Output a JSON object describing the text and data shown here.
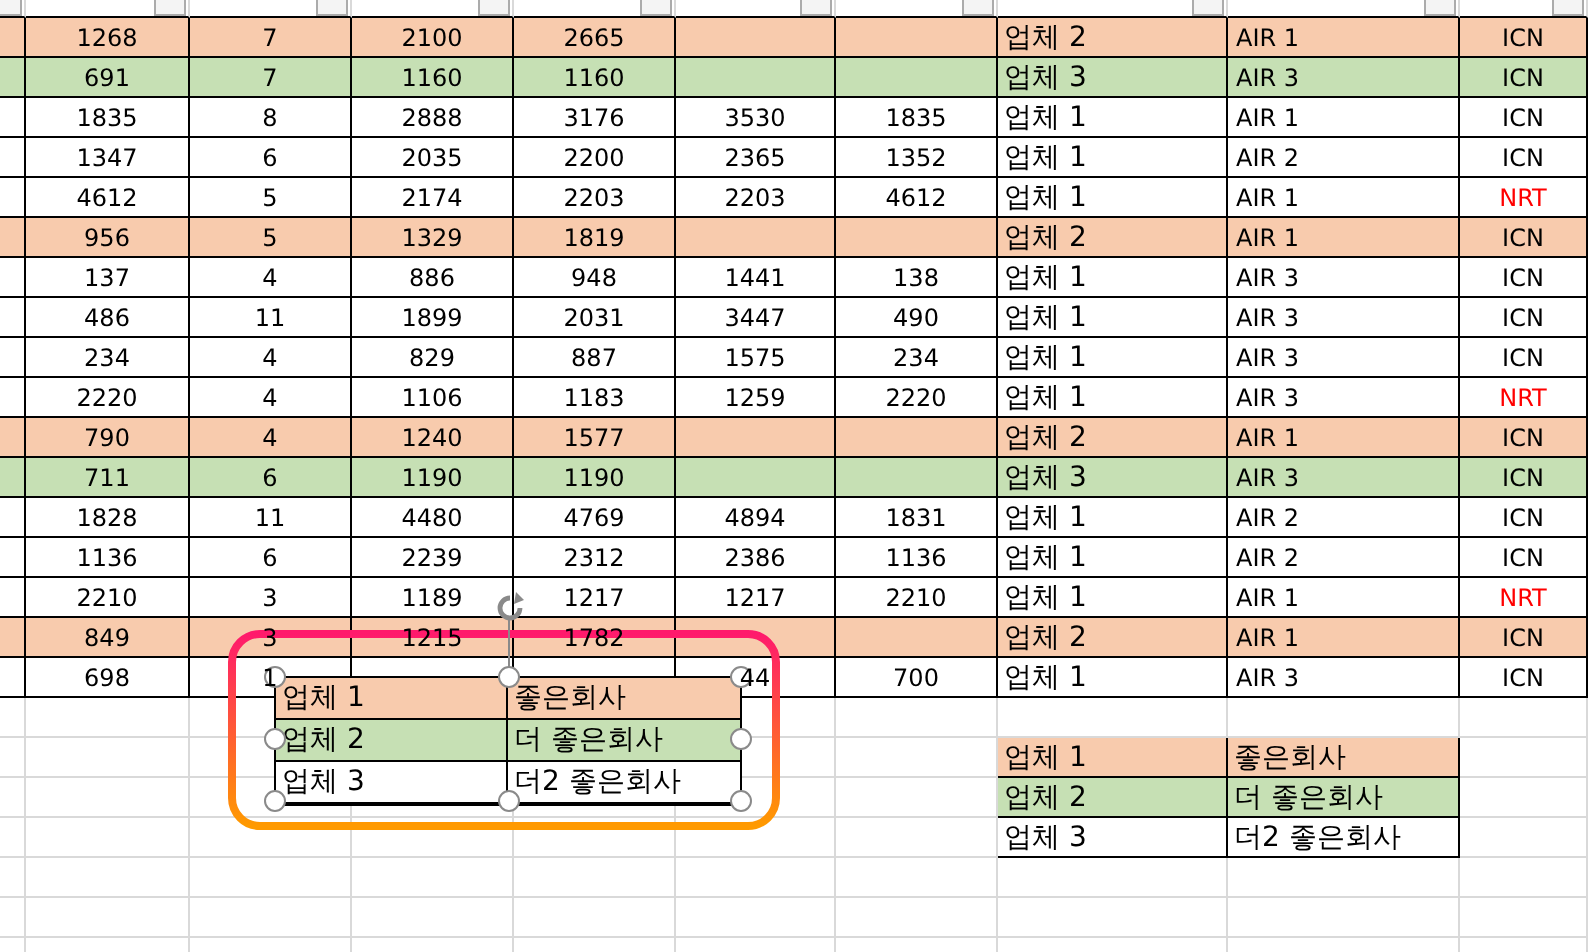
{
  "rows": [
    {
      "color": "#f8cbad",
      "values": {
        "column_2": "1268",
        "column_3": "7",
        "column_4": "2100",
        "column_5": "2665"
      },
      "company": "업체 2",
      "air": "AIR 1",
      "airport": "ICN",
      "flagged": false
    },
    {
      "color": "#c6e0b4",
      "values": {
        "column_2": "691",
        "column_3": "7",
        "column_4": "1160",
        "column_5": "1160"
      },
      "company": "업체 3",
      "air": "AIR 3",
      "airport": "ICN",
      "flagged": false
    },
    {
      "color": "#ffffff",
      "values": {
        "column_2": "1835",
        "column_3": "8",
        "column_4": "2888",
        "column_5": "3176",
        "column_6": "3530",
        "column_7": "1835"
      },
      "company": "업체 1",
      "air": "AIR 1",
      "airport": "ICN",
      "flagged": false
    },
    {
      "color": "#ffffff",
      "values": {
        "column_2": "1347",
        "column_3": "6",
        "column_4": "2035",
        "column_5": "2200",
        "column_6": "2365",
        "column_7": "1352"
      },
      "company": "업체 1",
      "air": "AIR 2",
      "airport": "ICN",
      "flagged": false
    },
    {
      "color": "#ffffff",
      "values": {
        "column_2": "4612",
        "column_3": "5",
        "column_4": "2174",
        "column_5": "2203",
        "column_6": "2203",
        "column_7": "4612"
      },
      "company": "업체 1",
      "air": "AIR 1",
      "airport": "NRT",
      "flagged": true
    },
    {
      "color": "#f8cbad",
      "values": {
        "column_2": "956",
        "column_3": "5",
        "column_4": "1329",
        "column_5": "1819"
      },
      "company": "업체 2",
      "air": "AIR 1",
      "airport": "ICN",
      "flagged": false
    },
    {
      "color": "#ffffff",
      "values": {
        "column_2": "137",
        "column_3": "4",
        "column_4": "886",
        "column_5": "948",
        "column_6": "1441",
        "column_7": "138"
      },
      "company": "업체 1",
      "air": "AIR 3",
      "airport": "ICN",
      "flagged": false
    },
    {
      "color": "#ffffff",
      "values": {
        "column_2": "486",
        "column_3": "11",
        "column_4": "1899",
        "column_5": "2031",
        "column_6": "3447",
        "column_7": "490"
      },
      "company": "업체 1",
      "air": "AIR 3",
      "airport": "ICN",
      "flagged": false
    },
    {
      "color": "#ffffff",
      "values": {
        "column_2": "234",
        "column_3": "4",
        "column_4": "829",
        "column_5": "887",
        "column_6": "1575",
        "column_7": "234"
      },
      "company": "업체 1",
      "air": "AIR 3",
      "airport": "ICN",
      "flagged": false
    },
    {
      "color": "#ffffff",
      "values": {
        "column_2": "2220",
        "column_3": "4",
        "column_4": "1106",
        "column_5": "1183",
        "column_6": "1259",
        "column_7": "2220"
      },
      "company": "업체 1",
      "air": "AIR 3",
      "airport": "NRT",
      "flagged": true
    },
    {
      "color": "#f8cbad",
      "values": {
        "column_2": "790",
        "column_3": "4",
        "column_4": "1240",
        "column_5": "1577"
      },
      "company": "업체 2",
      "air": "AIR 1",
      "airport": "ICN",
      "flagged": false
    },
    {
      "color": "#c6e0b4",
      "values": {
        "column_2": "711",
        "column_3": "6",
        "column_4": "1190",
        "column_5": "1190"
      },
      "company": "업체 3",
      "air": "AIR 3",
      "airport": "ICN",
      "flagged": false
    },
    {
      "color": "#ffffff",
      "values": {
        "column_2": "1828",
        "column_3": "11",
        "column_4": "4480",
        "column_5": "4769",
        "column_6": "4894",
        "column_7": "1831"
      },
      "company": "업체 1",
      "air": "AIR 2",
      "airport": "ICN",
      "flagged": false
    },
    {
      "color": "#ffffff",
      "values": {
        "column_2": "1136",
        "column_3": "6",
        "column_4": "2239",
        "column_5": "2312",
        "column_6": "2386",
        "column_7": "1136"
      },
      "company": "업체 1",
      "air": "AIR 2",
      "airport": "ICN",
      "flagged": false
    },
    {
      "color": "#ffffff",
      "values": {
        "column_2": "2210",
        "column_3": "3",
        "column_4": "1189",
        "column_5": "1217",
        "column_6": "1217",
        "column_7": "2210"
      },
      "company": "업체 1",
      "air": "AIR 1",
      "airport": "NRT",
      "flagged": true
    },
    {
      "color": "#f8cbad",
      "values": {
        "column_2": "849",
        "column_3": "3",
        "column_4": "1215",
        "column_5": "1782"
      },
      "company": "업체 2",
      "air": "AIR 1",
      "airport": "ICN",
      "flagged": false
    },
    {
      "color": "#ffffff",
      "values": {
        "column_2": "698",
        "column_3": "1",
        "column_6": "44",
        "column_7": "700"
      },
      "company": "업체 1",
      "air": "AIR 3",
      "airport": "ICN",
      "flagged": false
    }
  ],
  "lookup_table": [
    {
      "color": "#f8cbad",
      "company": "업체 1",
      "name": "좋은회사"
    },
    {
      "color": "#c6e0b4",
      "company": "업체 2",
      "name": "더 좋은회사"
    },
    {
      "color": "#ffffff",
      "company": "업체 3",
      "name": "더2 좋은회사"
    }
  ],
  "picture_table": [
    {
      "color": "#f8cbad",
      "company": "업체 1",
      "name": "좋은회사"
    },
    {
      "color": "#c6e0b4",
      "company": "업체 2",
      "name": "더 좋은회사"
    },
    {
      "color": "#ffffff",
      "company": "업체 3",
      "name": "더2 좋은회사"
    }
  ]
}
